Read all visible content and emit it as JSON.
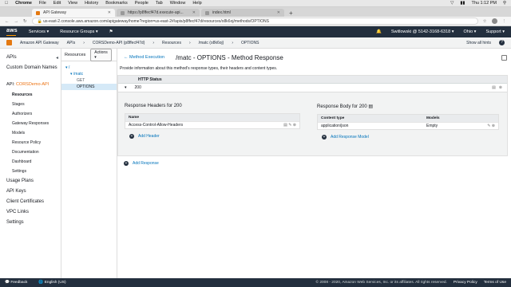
{
  "menubar": {
    "app": "Chrome",
    "items": [
      "File",
      "Edit",
      "View",
      "History",
      "Bookmarks",
      "People",
      "Tab",
      "Window",
      "Help"
    ],
    "clock": "Thu 1:12 PM"
  },
  "tabs": [
    {
      "label": "API Gateway"
    },
    {
      "label": "https://p8ffecf47d.execute-api..."
    },
    {
      "label": "index.html"
    }
  ],
  "address": {
    "url": "us-east-2.console.aws.amazon.com/apigateway/home?region=us-east-2#/apis/p8ffecf47d/resources/o8k6oj/methods/OPTIONS"
  },
  "awsnav": {
    "logo": "aws",
    "services": "Services",
    "resource_groups": "Resource Groups",
    "account": "Switlowski @ 5142-3168-6318",
    "region": "Ohio",
    "support": "Support"
  },
  "crumbs": {
    "service": "Amazon API Gateway",
    "apis": "APIs",
    "api": "CORSDemo-API (p8ffecf47d)",
    "resources": "Resources",
    "path": "/matc (o8k6oj)",
    "method": "OPTIONS",
    "show_hints": "Show all hints"
  },
  "sidebar": {
    "top": [
      "APIs",
      "Custom Domain Names"
    ],
    "api_prefix": "API:",
    "api_name": "CORSDemo-API",
    "sub": [
      "Resources",
      "Stages",
      "Authorizers",
      "Gateway Responses",
      "Models",
      "Resource Policy",
      "Documentation",
      "Dashboard",
      "Settings"
    ],
    "bottom": [
      "Usage Plans",
      "API Keys",
      "Client Certificates",
      "VPC Links",
      "Settings"
    ]
  },
  "resources": {
    "header": "Resources",
    "actions": "Actions",
    "tree": [
      "/",
      "/matc",
      "GET",
      "OPTIONS"
    ]
  },
  "main": {
    "back": "Method Execution",
    "title": "/matc - OPTIONS - Method Response",
    "desc": "Provide information about this method's response types, their headers and content types.",
    "http_status_header": "HTTP Status",
    "status": "200",
    "headers_title": "Response Headers for 200",
    "headers_col": "Name",
    "header_value": "Access-Control-Allow-Headers",
    "add_header": "Add Header",
    "body_title": "Response Body for 200",
    "content_type_col": "Content type",
    "models_col": "Models",
    "content_type": "application/json",
    "model": "Empty",
    "add_model": "Add Response Model",
    "add_response": "Add Response"
  },
  "footer": {
    "feedback": "Feedback",
    "language": "English (US)",
    "copyright": "© 2008 - 2020, Amazon Web Services, Inc. or its affiliates. All rights reserved.",
    "privacy": "Privacy Policy",
    "terms": "Terms of Use"
  },
  "colors": {
    "aws_nav": "#232f3e",
    "accent": "#ec7211",
    "link": "#0073bb"
  }
}
